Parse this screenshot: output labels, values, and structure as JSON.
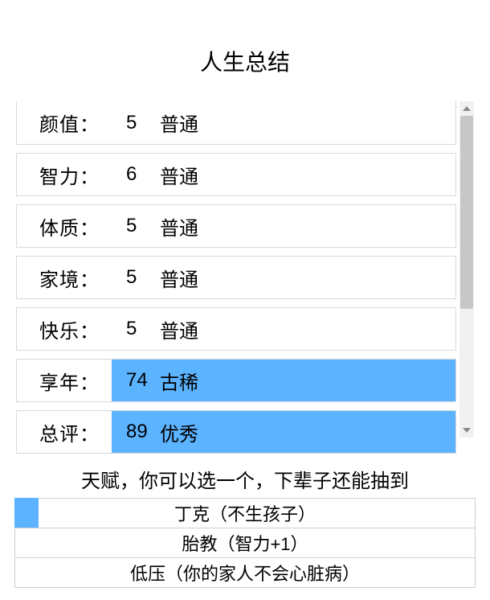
{
  "title": "人生总结",
  "highlight_color": "#5cb3ff",
  "stats": [
    {
      "label": "颜值：",
      "value": "5",
      "grade": "普通",
      "highlight": false
    },
    {
      "label": "智力：",
      "value": "6",
      "grade": "普通",
      "highlight": false
    },
    {
      "label": "体质：",
      "value": "5",
      "grade": "普通",
      "highlight": false
    },
    {
      "label": "家境：",
      "value": "5",
      "grade": "普通",
      "highlight": false
    },
    {
      "label": "快乐：",
      "value": "5",
      "grade": "普通",
      "highlight": false
    },
    {
      "label": "享年：",
      "value": "74",
      "grade": "古稀",
      "highlight": true
    },
    {
      "label": "总评：",
      "value": "89",
      "grade": "优秀",
      "highlight": true
    }
  ],
  "talent_prompt": "天赋，你可以选一个，下辈子还能抽到",
  "talents": [
    {
      "text": "丁克（不生孩子）",
      "selected": true
    },
    {
      "text": "胎教（智力+1）",
      "selected": false
    },
    {
      "text": "低压（你的家人不会心脏病）",
      "selected": false
    }
  ]
}
